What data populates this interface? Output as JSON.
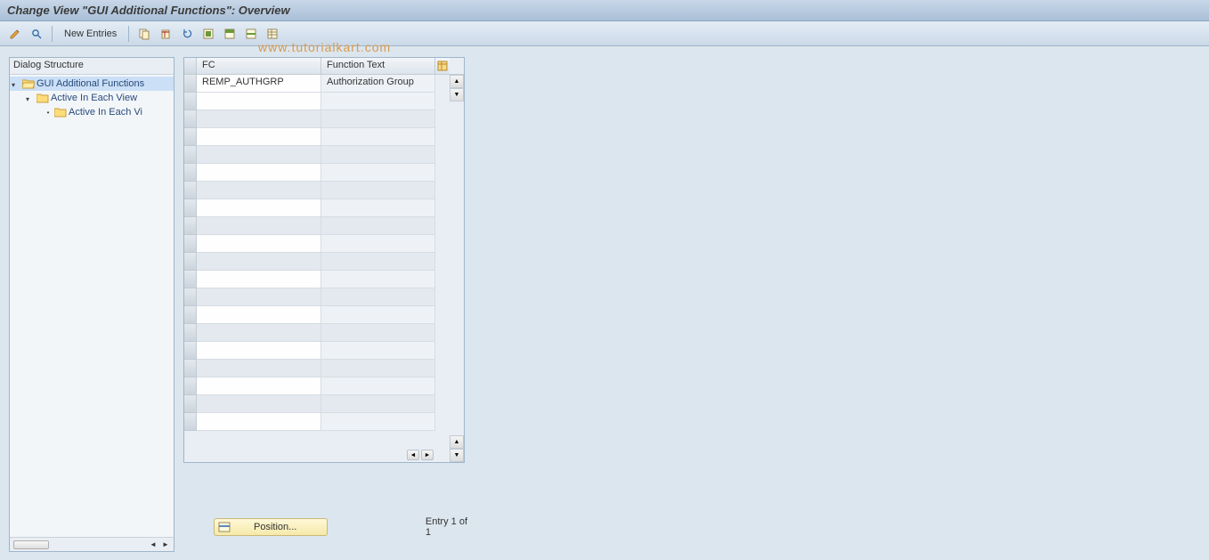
{
  "title": "Change View \"GUI Additional Functions\": Overview",
  "toolbar": {
    "new_entries_label": "New Entries"
  },
  "watermark": "www.tutorialkart.com",
  "tree": {
    "header": "Dialog Structure",
    "items": [
      {
        "label": "GUI Additional Functions",
        "indent": 0,
        "open": true,
        "toggle": true,
        "selected": true
      },
      {
        "label": "Active In Each View",
        "indent": 1,
        "open": false,
        "toggle": true,
        "selected": false
      },
      {
        "label": "Active In Each Vi",
        "indent": 2,
        "open": false,
        "toggle": false,
        "selected": false
      }
    ]
  },
  "grid": {
    "columns": {
      "fc": "FC",
      "ft": "Function Text"
    },
    "rows": [
      {
        "fc": "REMP_AUTHGRP",
        "ft": "Authorization Group"
      }
    ],
    "empty_rows": 19
  },
  "position_button_label": "Position...",
  "entry_status": "Entry 1 of 1"
}
